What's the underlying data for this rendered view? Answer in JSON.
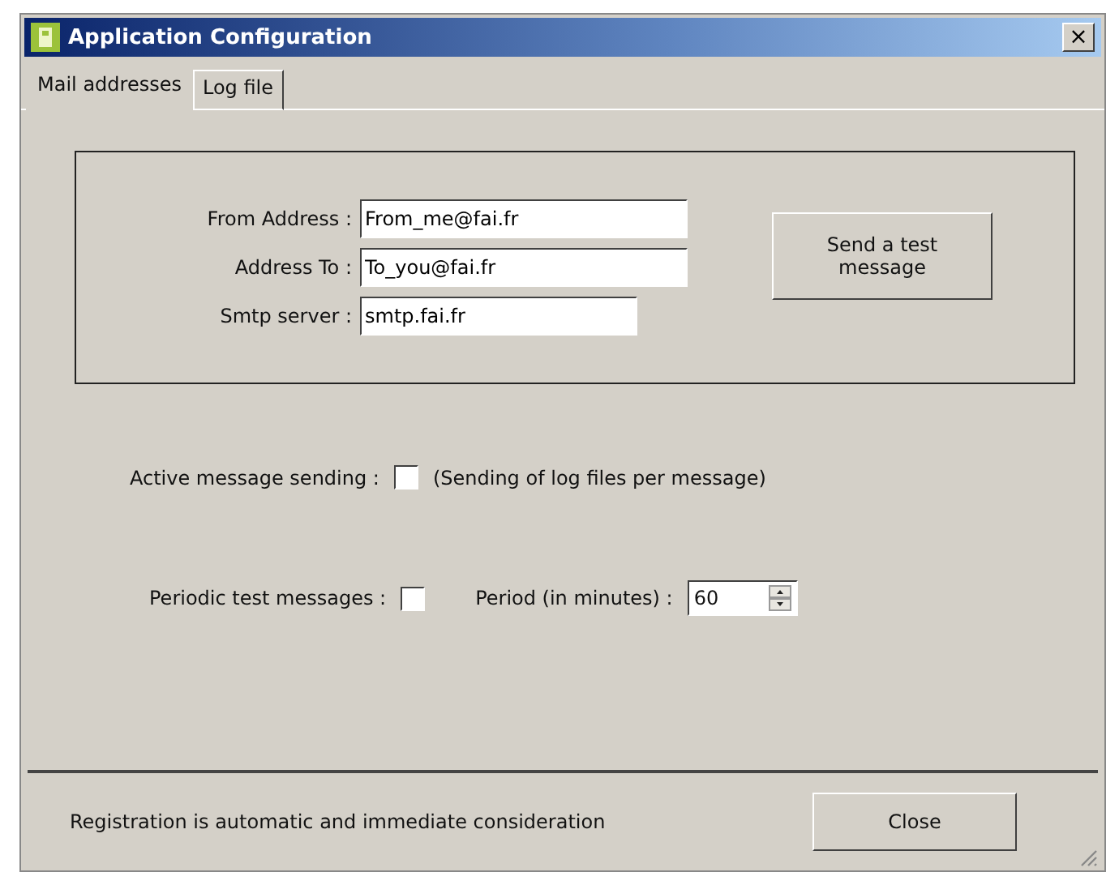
{
  "window": {
    "title": "Application Configuration",
    "close": "×"
  },
  "tabs": [
    {
      "label": "Mail addresses",
      "selected": true
    },
    {
      "label": "Log file",
      "selected": false
    }
  ],
  "mail_group": {
    "fields": [
      {
        "label": "From Address :",
        "value": "From_me@fai.fr",
        "kind": "wide"
      },
      {
        "label": "Address To :",
        "value": "To_you@fai.fr",
        "kind": "wide"
      },
      {
        "label": "Smtp server :",
        "value": "smtp.fai.fr",
        "kind": "narrow"
      }
    ],
    "test_button": "Send a test message"
  },
  "active_sending": {
    "label": "Active message sending :",
    "checked": false,
    "note": "(Sending of log files per message)"
  },
  "periodic": {
    "label": "Periodic test messages :",
    "checked": false,
    "period_label": "Period (in minutes) :",
    "period_value": "60"
  },
  "status_bar": {
    "text": "Registration is automatic and immediate consideration",
    "button": "Close"
  }
}
